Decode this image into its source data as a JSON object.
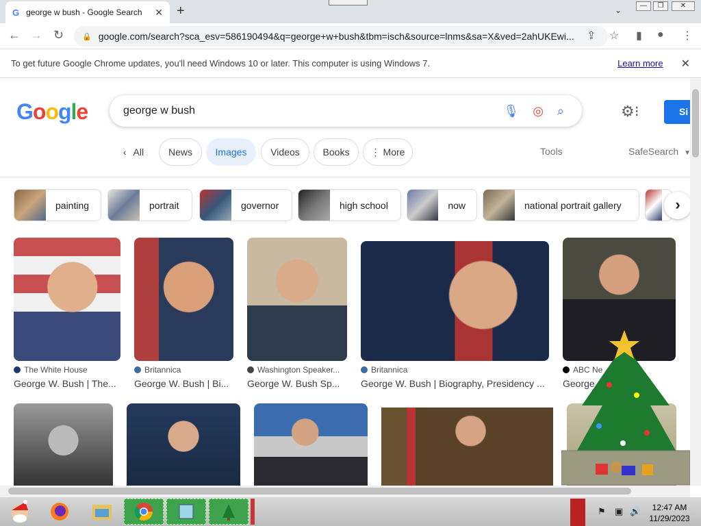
{
  "browser": {
    "tab_title": "george w bush - Google Search",
    "url": "google.com/search?sca_esv=586190494&q=george+w+bush&tbm=isch&source=lnms&sa=X&ved=2ahUKEwi..."
  },
  "infobar": {
    "message": "To get future Google Chrome updates, you'll need Windows 10 or later. This computer is using Windows 7.",
    "learn_more": "Learn more"
  },
  "google": {
    "logo_letters": [
      "G",
      "o",
      "o",
      "g",
      "l",
      "e"
    ],
    "query": "george w bush",
    "signin_label": "Si"
  },
  "filters": {
    "all": "All",
    "tabs": [
      "News",
      "Images",
      "Videos",
      "Books",
      "More"
    ],
    "tools": "Tools",
    "safesearch": "SafeSearch"
  },
  "chips": [
    "painting",
    "portrait",
    "governor",
    "high school",
    "now",
    "national portrait gallery"
  ],
  "results": [
    {
      "source": "The White House",
      "caption": "George W. Bush | The..."
    },
    {
      "source": "Britannica",
      "caption": "George W. Bush | Bi..."
    },
    {
      "source": "Washington Speaker...",
      "caption": "George W. Bush Sp..."
    },
    {
      "source": "Britannica",
      "caption": "George W. Bush | Biography, Presidency ..."
    },
    {
      "source": "ABC Ne",
      "caption": "George ...200..."
    }
  ],
  "taskbar": {
    "time": "12:47 AM",
    "date": "11/29/2023"
  },
  "colors": {
    "accent": "#1a73e8",
    "chrome_frame": "#dee1e6"
  }
}
